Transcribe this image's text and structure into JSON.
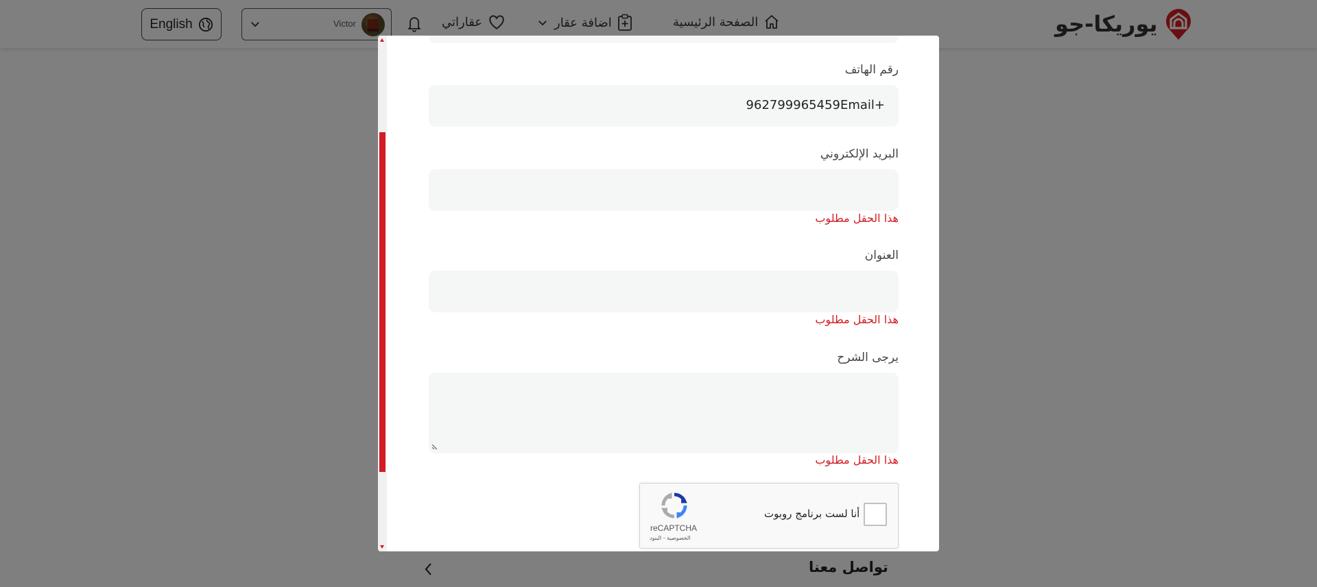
{
  "header": {
    "language_label": "English",
    "user_name": "Victor",
    "nav": {
      "my_properties": "عقاراتي",
      "add_property": "اضافة عقار",
      "home": "الصفحة الرئيسية"
    },
    "logo_text": "يوريكا-جو"
  },
  "form": {
    "phone_label": "رقم الهاتف",
    "phone_value": "962799965459Email+",
    "email_label": "البريد الإلكتروني",
    "email_value": "",
    "email_error": "هذا الحقل مطلوب",
    "address_label": "العنوان",
    "address_value": "",
    "address_error": "هذا الحقل مطلوب",
    "explain_label": "يرجى الشرح",
    "explain_value": "",
    "explain_error": "هذا الحقل مطلوب"
  },
  "recaptcha": {
    "label": "أنا لست برنامج روبوت",
    "brand": "reCAPTCHA",
    "links": "الخصوصية - البنود"
  },
  "footer": {
    "contact_title": "تواصل معنا"
  },
  "colors": {
    "accent": "#d31c24",
    "field_bg": "#f5f6f6",
    "overlay": "rgba(0,0,0,0.5)"
  }
}
